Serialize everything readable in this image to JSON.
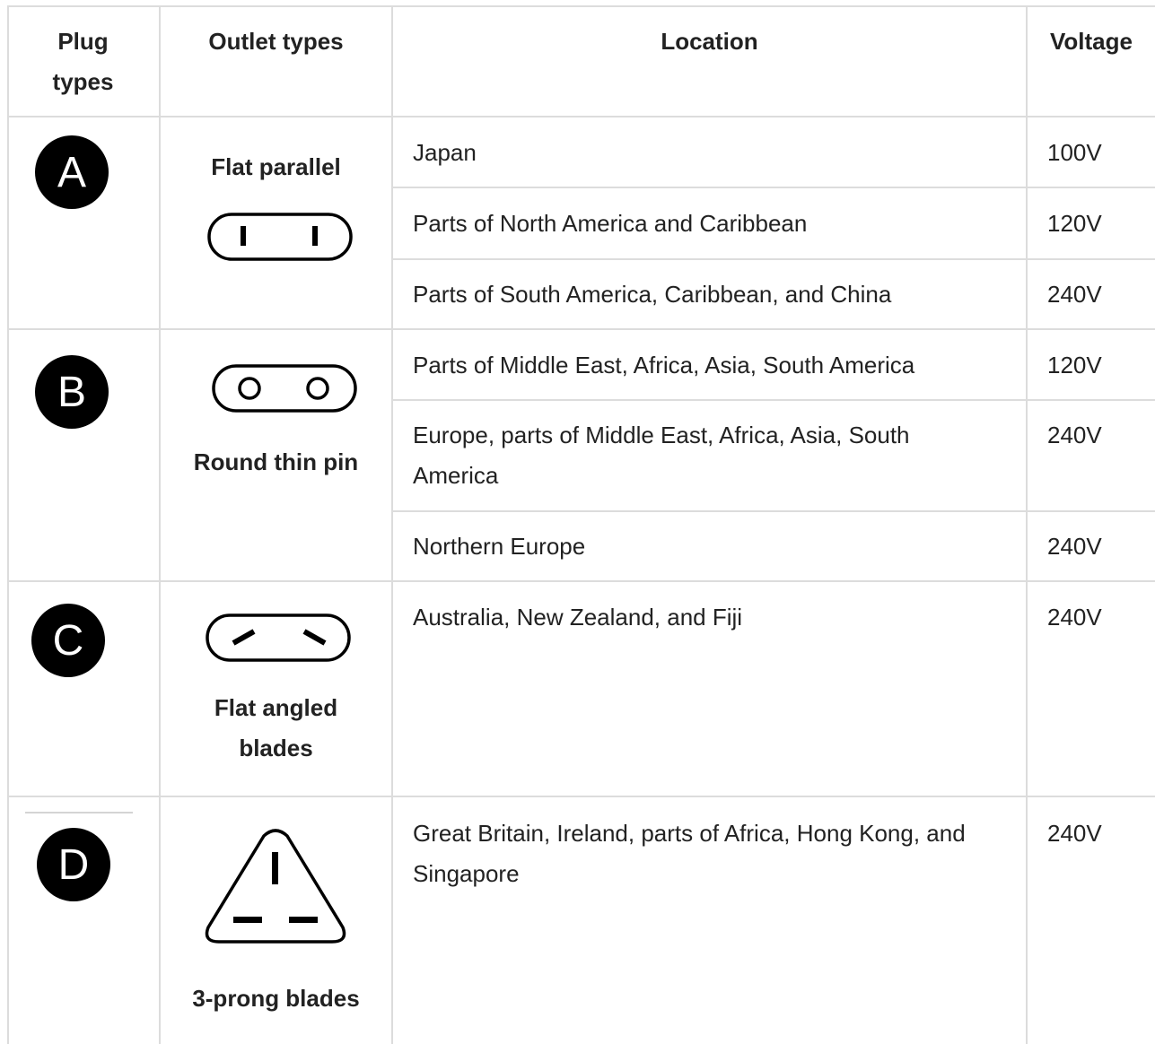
{
  "header": {
    "plug_types": "Plug types",
    "outlet_types": "Outlet types",
    "location": "Location",
    "voltage": "Voltage"
  },
  "plugs": [
    {
      "letter": "A",
      "icon": "plug-a-badge-icon",
      "outlet_name": "Flat parallel",
      "outlet_icon": "flat-parallel-outlet-icon",
      "rows": [
        {
          "location": "Japan",
          "voltage": "100V"
        },
        {
          "location": "Parts of North America and Caribbean",
          "voltage": "120V"
        },
        {
          "location": "Parts of South America, Caribbean, and China",
          "voltage": "240V"
        }
      ]
    },
    {
      "letter": "B",
      "icon": "plug-b-badge-icon",
      "outlet_name": "Round thin pin",
      "outlet_icon": "round-thin-pin-outlet-icon",
      "rows": [
        {
          "location": "Parts of Middle East, Africa, Asia, South America",
          "voltage": "120V"
        },
        {
          "location": "Europe, parts of Middle East, Africa, Asia, South America",
          "voltage": "240V"
        },
        {
          "location": "Northern Europe",
          "voltage": "240V"
        }
      ]
    },
    {
      "letter": "C",
      "icon": "plug-c-badge-icon",
      "outlet_name": "Flat angled blades",
      "outlet_icon": "flat-angled-blades-outlet-icon",
      "rows": [
        {
          "location": "Australia, New Zealand, and Fiji",
          "voltage": "240V"
        }
      ]
    },
    {
      "letter": "D",
      "icon": "plug-d-badge-icon",
      "outlet_name": "3-prong blades",
      "outlet_icon": "three-prong-blades-outlet-icon",
      "rows": [
        {
          "location": "Great Britain, Ireland, parts of Africa, Hong Kong, and Singapore",
          "voltage": "240V"
        }
      ]
    }
  ],
  "colors": {
    "border": "#dcdcdc",
    "text": "#222222",
    "badge": "#000000"
  }
}
